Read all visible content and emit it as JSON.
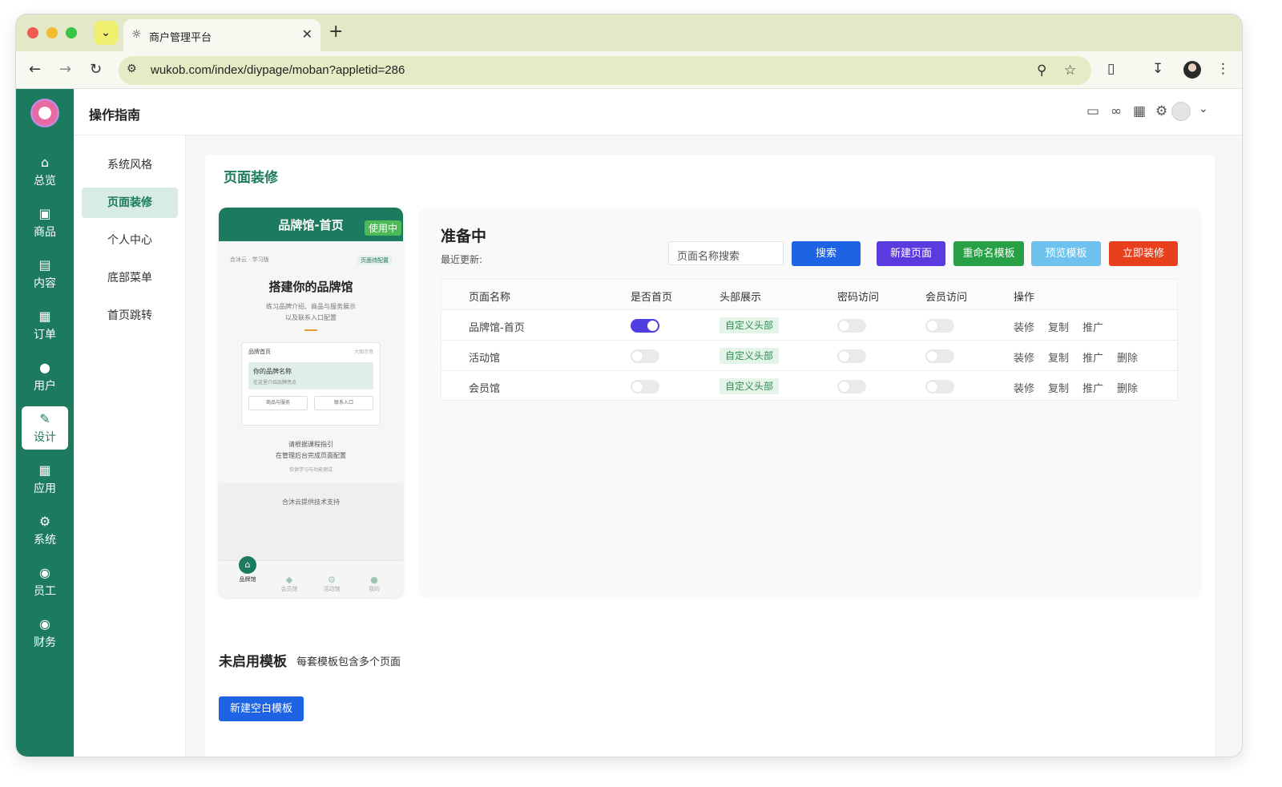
{
  "browser": {
    "tab_title": "商户管理平台",
    "url": "wukob.com/index/diypage/moban?appletid=286"
  },
  "header": {
    "title": "操作指南"
  },
  "sidebar": {
    "items": [
      {
        "label": "总览",
        "icon": "home-icon"
      },
      {
        "label": "商品",
        "icon": "bag-icon"
      },
      {
        "label": "内容",
        "icon": "document-icon"
      },
      {
        "label": "订单",
        "icon": "clipboard-icon"
      },
      {
        "label": "用户",
        "icon": "user-icon"
      },
      {
        "label": "设计",
        "icon": "paint-roller-icon"
      },
      {
        "label": "应用",
        "icon": "grid-icon"
      },
      {
        "label": "系统",
        "icon": "gear-icon"
      },
      {
        "label": "员工",
        "icon": "lock-icon"
      },
      {
        "label": "财务",
        "icon": "money-bag-icon"
      }
    ],
    "active": "设计"
  },
  "subnav": {
    "items": [
      "系统风格",
      "页面装修",
      "个人中心",
      "底部菜单",
      "首页跳转"
    ],
    "active": "页面装修"
  },
  "main": {
    "title": "页面装修",
    "preview": {
      "title": "品牌馆-首页",
      "badge": "使用中",
      "crumb": "合沐云 · 学习版",
      "tag": "页面待配置",
      "headline": "搭建你的品牌馆",
      "desc_1": "练习品牌介绍、商品与服务展示",
      "desc_2": "以及联系入口配置",
      "card_header": "品牌首页",
      "card_header_right": "大图示意",
      "brand_name": "你的品牌名称",
      "brand_sub": "在这里介绍品牌亮点",
      "btn_1": "商品与服务",
      "btn_2": "联系入口",
      "guide_1": "请根据课程指引",
      "guide_2": "在管理后台完成页面配置",
      "guide_3": "仅供学习与功能测试",
      "support": "合沐云提供技术支持",
      "tabs": [
        "品牌馆",
        "会员馆",
        "活动馆",
        "我的"
      ]
    },
    "panel": {
      "status": "准备中",
      "updated_label": "最近更新:",
      "search_placeholder": "页面名称搜索",
      "buttons": {
        "search": "搜索",
        "new_page": "新建页面",
        "rename": "重命名模板",
        "preview": "预览模板",
        "decorate": "立即装修"
      },
      "columns": [
        "页面名称",
        "是否首页",
        "头部展示",
        "密码访问",
        "会员访问",
        "操作"
      ],
      "rows": [
        {
          "name": "品牌馆-首页",
          "is_home": true,
          "header": "自定义头部",
          "password": false,
          "member": false,
          "actions": [
            "装修",
            "复制",
            "推广"
          ]
        },
        {
          "name": "活动馆",
          "is_home": false,
          "header": "自定义头部",
          "password": false,
          "member": false,
          "actions": [
            "装修",
            "复制",
            "推广",
            "删除"
          ]
        },
        {
          "name": "会员馆",
          "is_home": false,
          "header": "自定义头部",
          "password": false,
          "member": false,
          "actions": [
            "装修",
            "复制",
            "推广",
            "删除"
          ]
        }
      ]
    },
    "unused": {
      "title": "未启用模板",
      "subtitle": "每套模板包含多个页面",
      "new_blank": "新建空白模板"
    }
  },
  "colors": {
    "brand_green": "#1c7a5e",
    "search_blue": "#1d63e3",
    "new_page_purple": "#5b3be0",
    "rename_green": "#27a046",
    "preview_lightblue": "#6ec3ee",
    "decorate_red": "#e8401c",
    "toggle_on": "#4f3fe0"
  }
}
